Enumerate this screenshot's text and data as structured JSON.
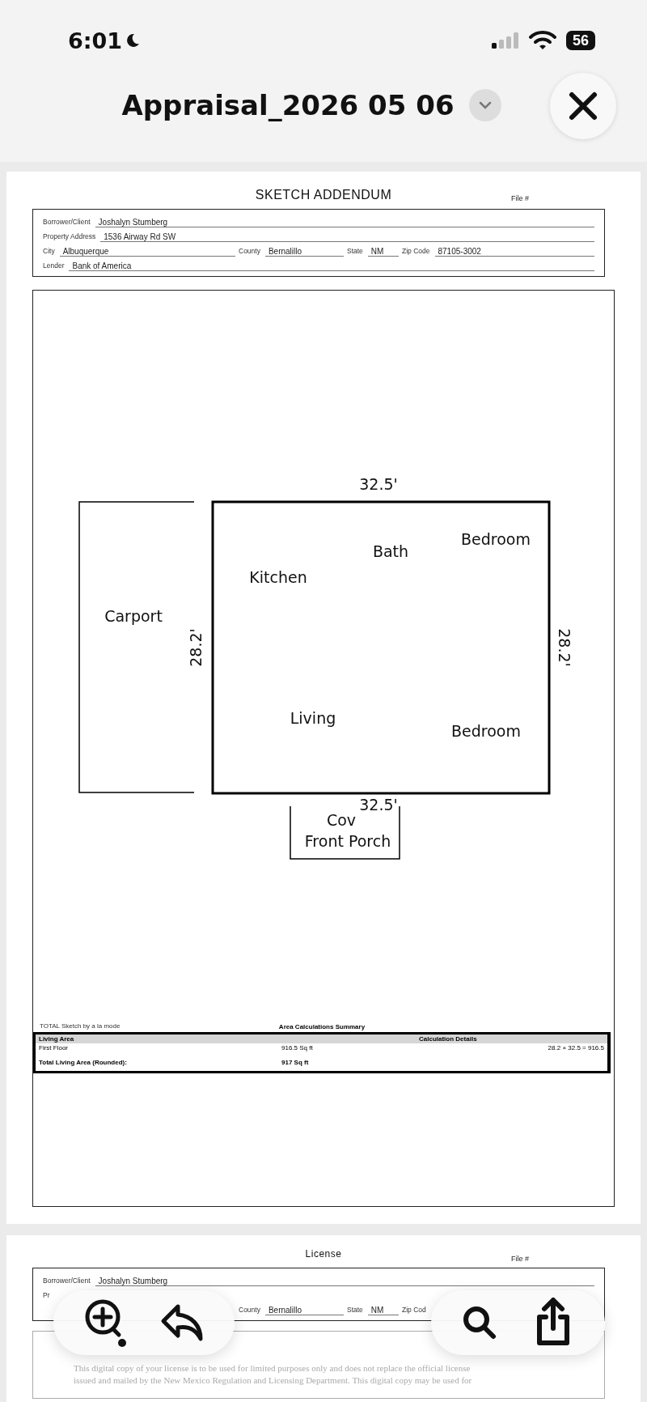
{
  "status_bar": {
    "time": "6:01",
    "battery": "56"
  },
  "header": {
    "title": "Appraisal_2026 05 06"
  },
  "pages": [
    {
      "title": "SKETCH ADDENDUM",
      "file_label": "File #",
      "fields": [
        [
          {
            "label": "Borrower/Client",
            "value": "Joshalyn Stumberg"
          }
        ],
        [
          {
            "label": "Property Address",
            "value": "1536 Airway Rd SW"
          }
        ],
        [
          {
            "label": "City",
            "value": "Albuquerque"
          },
          {
            "label": "County",
            "value": "Bernalillo"
          },
          {
            "label": "State",
            "value": "NM"
          },
          {
            "label": "Zip Code",
            "value": "87105-3002"
          }
        ],
        [
          {
            "label": "Lender",
            "value": "Bank of America"
          }
        ]
      ],
      "sketch": {
        "labels": [
          {
            "text": "32.5'"
          },
          {
            "text": "Bath"
          },
          {
            "text": "Bedroom"
          },
          {
            "text": "Kitchen"
          },
          {
            "text": "Carport"
          },
          {
            "text": "28.2'"
          },
          {
            "text": "28.2'"
          },
          {
            "text": "Living"
          },
          {
            "text": "Bedroom"
          },
          {
            "text": "32.5'"
          },
          {
            "text": "Cov"
          },
          {
            "text": "Front Porch"
          }
        ]
      },
      "area_summary": {
        "credit": "TOTAL Sketch by a la mode",
        "title": "Area Calculations Summary",
        "columns": [
          "Living Area",
          "Calculation Details"
        ],
        "rows": [
          {
            "name": "First Floor",
            "area": "916.5 Sq ft",
            "calculation": "28.2 × 32.5 = 916.5"
          }
        ],
        "total": {
          "label": "Total Living Area (Rounded):",
          "area": "917 Sq ft"
        }
      }
    },
    {
      "title": "License",
      "file_label": "File #",
      "fields": [
        [
          {
            "label": "Borrower/Client",
            "value": "Joshalyn Stumberg"
          }
        ],
        [
          {
            "label": "Pr"
          }
        ],
        [
          {
            "label": "County",
            "value": "Bernalillo"
          },
          {
            "label": "State",
            "value": "NM"
          },
          {
            "label": "Zip Cod"
          }
        ]
      ],
      "notice": [
        "This digital copy of your license is to be used for limited purposes only and does not replace the official license",
        "issued and mailed by the New Mexico Regulation and Licensing Department. This digital copy may be used for"
      ]
    }
  ]
}
